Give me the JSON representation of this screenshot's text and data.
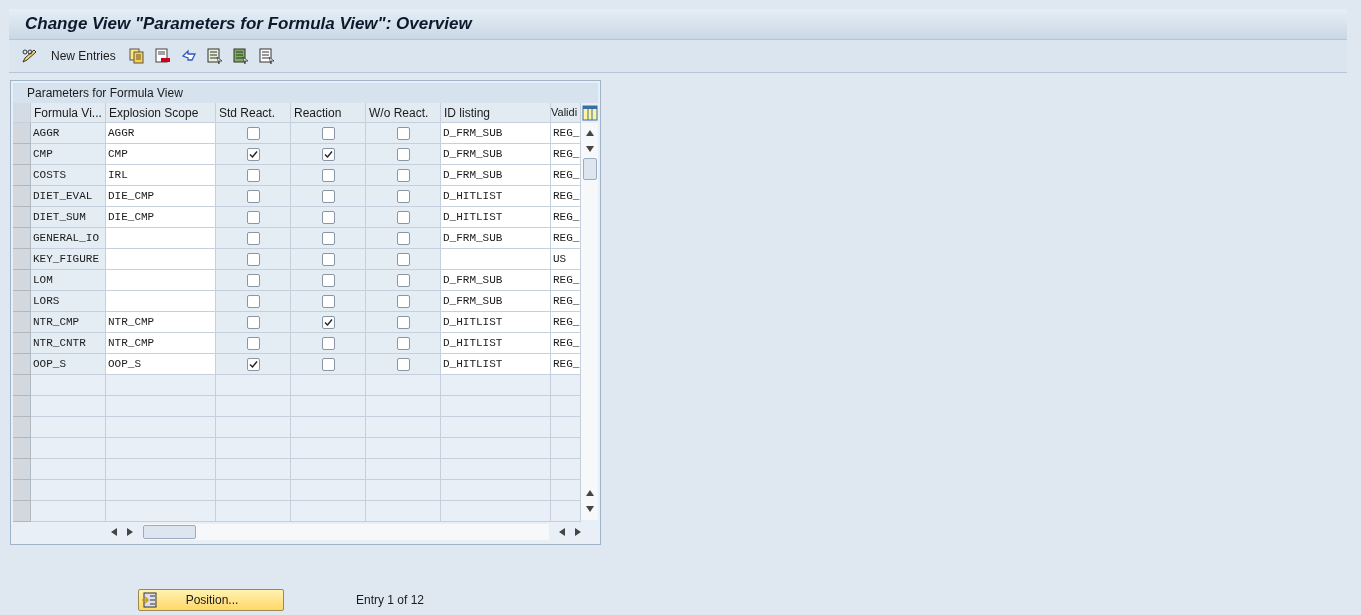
{
  "window": {
    "title": "Change View \"Parameters for Formula View\": Overview"
  },
  "toolbar": {
    "buttons": [
      {
        "kind": "edit"
      },
      {
        "kind": "text",
        "label": "New Entries"
      },
      {
        "kind": "copy"
      },
      {
        "kind": "delete"
      },
      {
        "kind": "undo"
      },
      {
        "kind": "select-all"
      },
      {
        "kind": "select-block"
      },
      {
        "kind": "deselect"
      }
    ]
  },
  "table": {
    "title": "Parameters for Formula View",
    "columns": [
      "Formula Vi...",
      "Explosion Scope",
      "Std React.",
      "Reaction",
      "W/o React.",
      "ID listing",
      "Validi"
    ],
    "rows": [
      {
        "formula_view": "AGGR",
        "explosion_scope": "AGGR",
        "std_react": false,
        "reaction": false,
        "wo_react": false,
        "id_listing": "D_FRM_SUB",
        "column_7": "REG_"
      },
      {
        "formula_view": "CMP",
        "explosion_scope": "CMP",
        "std_react": true,
        "reaction": true,
        "wo_react": false,
        "id_listing": "D_FRM_SUB",
        "column_7": "REG_"
      },
      {
        "formula_view": "COSTS",
        "explosion_scope": "IRL",
        "std_react": false,
        "reaction": false,
        "wo_react": false,
        "id_listing": "D_FRM_SUB",
        "column_7": "REG_"
      },
      {
        "formula_view": "DIET_EVAL",
        "explosion_scope": "DIE_CMP",
        "std_react": false,
        "reaction": false,
        "wo_react": false,
        "id_listing": "D_HITLIST",
        "column_7": "REG_"
      },
      {
        "formula_view": "DIET_SUM",
        "explosion_scope": "DIE_CMP",
        "std_react": false,
        "reaction": false,
        "wo_react": false,
        "id_listing": "D_HITLIST",
        "column_7": "REG_"
      },
      {
        "formula_view": "GENERAL_IO",
        "explosion_scope": "",
        "std_react": false,
        "reaction": false,
        "wo_react": false,
        "id_listing": "D_FRM_SUB",
        "column_7": "REG_"
      },
      {
        "formula_view": "KEY_FIGURE",
        "explosion_scope": "",
        "std_react": false,
        "reaction": false,
        "wo_react": false,
        "id_listing": "",
        "column_7": "US"
      },
      {
        "formula_view": "LOM",
        "explosion_scope": "",
        "std_react": false,
        "reaction": false,
        "wo_react": false,
        "id_listing": "D_FRM_SUB",
        "column_7": "REG_"
      },
      {
        "formula_view": "LORS",
        "explosion_scope": "",
        "std_react": false,
        "reaction": false,
        "wo_react": false,
        "id_listing": "D_FRM_SUB",
        "column_7": "REG_"
      },
      {
        "formula_view": "NTR_CMP",
        "explosion_scope": "NTR_CMP",
        "std_react": false,
        "reaction": true,
        "wo_react": false,
        "id_listing": "D_HITLIST",
        "column_7": "REG_"
      },
      {
        "formula_view": "NTR_CNTR",
        "explosion_scope": "NTR_CMP",
        "std_react": false,
        "reaction": false,
        "wo_react": false,
        "id_listing": "D_HITLIST",
        "column_7": "REG_"
      },
      {
        "formula_view": "OOP_S",
        "explosion_scope": "OOP_S",
        "std_react": true,
        "reaction": false,
        "wo_react": false,
        "id_listing": "D_HITLIST",
        "column_7": "REG_"
      }
    ]
  },
  "footer": {
    "position_button": "Position...",
    "entry_count": "Entry 1 of 12"
  }
}
